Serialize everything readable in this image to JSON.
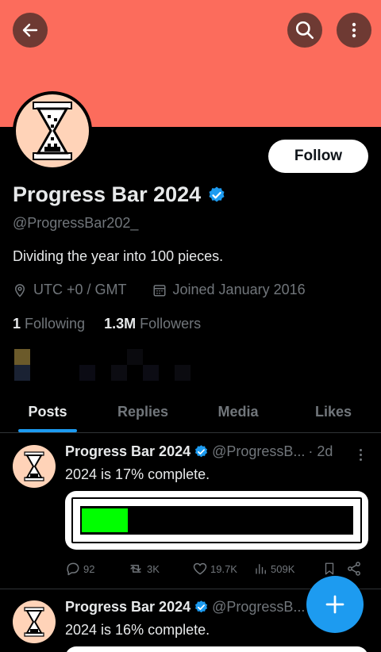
{
  "colors": {
    "banner": "#fc6c5c",
    "accent": "#1d9bf0",
    "progress_fill": "#00ff00"
  },
  "header": {
    "back_icon": "arrow-left-icon",
    "search_icon": "search-icon",
    "more_icon": "more-vertical-icon"
  },
  "profile": {
    "name": "Progress Bar 2024",
    "handle": "@ProgressBar202_",
    "bio": "Dividing the year into 100 pieces.",
    "location": "UTC +0 / GMT",
    "joined": "Joined January 2016",
    "following_count": "1",
    "following_label": "Following",
    "followers_count": "1.3M",
    "followers_label": "Followers",
    "follow_label": "Follow"
  },
  "tabs": [
    {
      "label": "Posts",
      "active": true
    },
    {
      "label": "Replies",
      "active": false
    },
    {
      "label": "Media",
      "active": false
    },
    {
      "label": "Likes",
      "active": false
    }
  ],
  "posts": [
    {
      "name": "Progress Bar 2024",
      "handle": "@ProgressB...",
      "time": "· 2d",
      "text": "2024 is 17% complete.",
      "progress": 0.17,
      "replies": "92",
      "reposts": "3K",
      "likes": "19.7K",
      "views": "509K"
    },
    {
      "name": "Progress Bar 2024",
      "handle": "@ProgressB...",
      "text": "2024 is 16% complete."
    }
  ]
}
